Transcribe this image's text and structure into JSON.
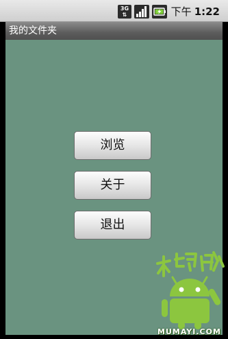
{
  "status_bar": {
    "network_label": "3G",
    "network_icon": "network-3g-icon",
    "signal_icon": "signal-strength-icon",
    "battery_icon": "battery-charging-icon",
    "clock_period": "下午",
    "clock_time": "1:22"
  },
  "app": {
    "title": "我的文件夹"
  },
  "menu": {
    "browse_label": "浏览",
    "about_label": "关于",
    "exit_label": "退出"
  },
  "watermark": {
    "logo_icon": "android-robot-icon",
    "chars": "木蚂蚁",
    "url": "MUMAYI.COM"
  },
  "colors": {
    "background": "#6a9380",
    "watermark_green": "#8cc63f"
  }
}
